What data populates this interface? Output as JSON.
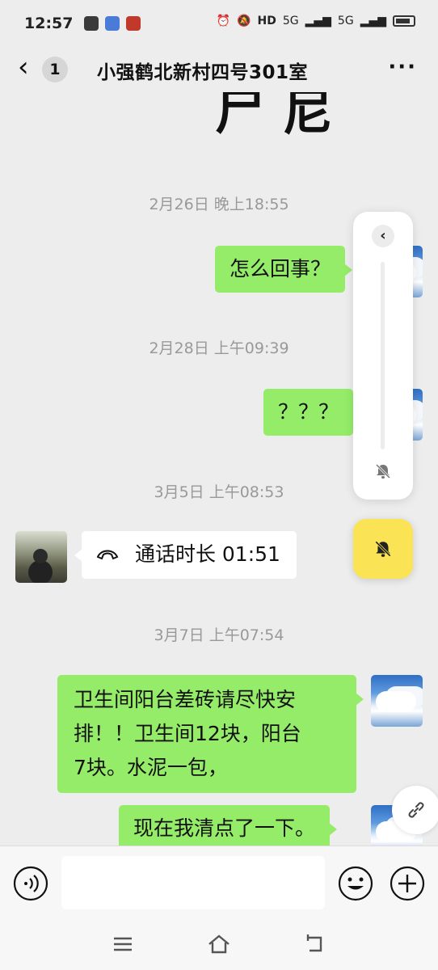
{
  "status_bar": {
    "time": "12:57",
    "network_left": "5G",
    "network_right": "5G"
  },
  "header": {
    "back_label": "‹",
    "unread_count": "1",
    "title": "小强鹤北新村四号301室",
    "more_label": "···"
  },
  "chat": {
    "top_fragment": "尸 尼",
    "messages": [
      {
        "type": "timestamp",
        "text": "2月26日 晚上18:55"
      },
      {
        "type": "outgoing",
        "text": "怎么回事？"
      },
      {
        "type": "timestamp",
        "text": "2月28日 上午09:39"
      },
      {
        "type": "outgoing",
        "text": "？？？"
      },
      {
        "type": "timestamp",
        "text": "3月5日 上午08:53"
      },
      {
        "type": "incoming_call",
        "text": "通话时长 01:51"
      },
      {
        "type": "timestamp",
        "text": "3月7日 上午07:54"
      },
      {
        "type": "outgoing",
        "lines": [
          "卫生间阳台差砖请尽快安",
          "排！！卫生间12块，阳台",
          "7块。水泥一包，"
        ]
      },
      {
        "type": "outgoing",
        "text": "现在我清点了一下。"
      }
    ]
  },
  "float_panel": {
    "collapse_label": "‹"
  },
  "input": {
    "placeholder": ""
  },
  "colors": {
    "outgoing_bubble": "#95ec69",
    "incoming_bubble": "#ffffff",
    "background": "#ededed",
    "bell_button": "#fbe356"
  }
}
